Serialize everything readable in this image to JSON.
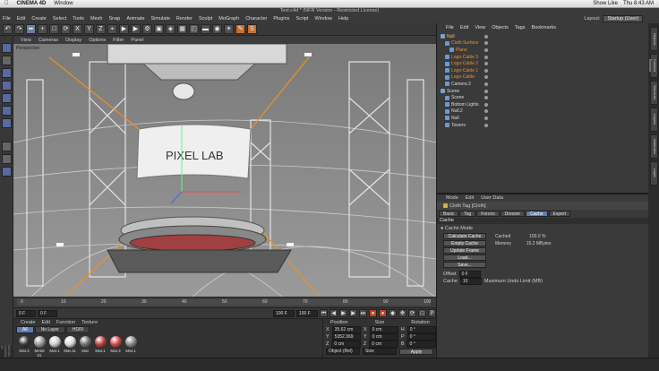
{
  "mac_menubar": {
    "app": "CINEMA 4D",
    "menu": "Window",
    "status_right": [
      "Show Like",
      "Thu 8:43 AM"
    ]
  },
  "app_title": "Test.c4d * (NFR Version - Restricted License)",
  "main_menu": [
    "File",
    "Edit",
    "Create",
    "Select",
    "Tools",
    "Mesh",
    "Snap",
    "Animate",
    "Simulate",
    "Render",
    "Sculpt",
    "MoGraph",
    "Character",
    "Plugins",
    "Script",
    "Window",
    "Help"
  ],
  "layout": {
    "label": "Layout:",
    "value": "Startup (User)"
  },
  "viewport": {
    "menu": [
      "View",
      "Cameras",
      "Display",
      "Options",
      "Filter",
      "Panel"
    ],
    "label": "Perspective",
    "screen_text": "PIXEL LAB"
  },
  "timeline": {
    "ticks": [
      "0",
      "10",
      "20",
      "30",
      "40",
      "50",
      "60",
      "70",
      "80",
      "90",
      "100"
    ],
    "frame_label": "0 F"
  },
  "playback": {
    "start": "0 F",
    "current": "0 F",
    "end": "100 F",
    "max": "100 F"
  },
  "material_manager": {
    "menu": [
      "Create",
      "Edit",
      "Function",
      "Texture"
    ],
    "tabs": [
      "All",
      "No Layer",
      "HDRI"
    ],
    "materials": [
      {
        "name": "Mat.3",
        "color": "#3a3a3a"
      },
      {
        "name": "Metal 01",
        "color": "#9a9a9a"
      },
      {
        "name": "Mat.1",
        "color": "#cfcfcf"
      },
      {
        "name": "Mat.11",
        "color": "#dcdcdc"
      },
      {
        "name": "Mat",
        "color": "#707070"
      },
      {
        "name": "Mat.1",
        "color": "#bb4444"
      },
      {
        "name": "Mat.3",
        "color": "#d04a4a"
      },
      {
        "name": "Mat.1",
        "color": "#8a8a8a"
      }
    ]
  },
  "coordinates": {
    "headers": [
      "Position",
      "Size",
      "Rotation"
    ],
    "rows": [
      {
        "axis": "X",
        "pos": "35.62 cm",
        "size_axis": "X",
        "size": "0 cm",
        "rot_axis": "H",
        "rot": "0 °"
      },
      {
        "axis": "Y",
        "pos": "5352.369 cm",
        "size_axis": "Y",
        "size": "0 cm",
        "rot_axis": "P",
        "rot": "0 °"
      },
      {
        "axis": "Z",
        "pos": "0 cm",
        "size_axis": "Z",
        "size": "0 cm",
        "rot_axis": "B",
        "rot": "0 °"
      }
    ],
    "mode_object": "Object (Rel)",
    "mode_size": "Size",
    "apply": "Apply"
  },
  "object_manager": {
    "menu": [
      "File",
      "Edit",
      "View",
      "Objects",
      "Tags",
      "Bookmarks"
    ],
    "objects": [
      {
        "name": "Null",
        "color": "#e8c060",
        "indent": 0
      },
      {
        "name": "Cloth Surface",
        "color": "#e89030",
        "indent": 1
      },
      {
        "name": "Plane",
        "color": "#e89030",
        "indent": 2
      },
      {
        "name": "Logo-Cable 3",
        "color": "#e89030",
        "indent": 1
      },
      {
        "name": "Logo-Cable 2",
        "color": "#e89030",
        "indent": 1
      },
      {
        "name": "Logo-Cable 1",
        "color": "#e89030",
        "indent": 1
      },
      {
        "name": "Logo-Cable",
        "color": "#e89030",
        "indent": 1
      },
      {
        "name": "Camera 2",
        "color": "#dddddd",
        "indent": 1
      },
      {
        "name": "Scene",
        "color": "#dddddd",
        "indent": 0
      },
      {
        "name": "Scene",
        "color": "#dddddd",
        "indent": 1
      },
      {
        "name": "Bottom Lights",
        "color": "#dddddd",
        "indent": 1
      },
      {
        "name": "Null.2",
        "color": "#dddddd",
        "indent": 1
      },
      {
        "name": "Null",
        "color": "#dddddd",
        "indent": 1
      },
      {
        "name": "Towers",
        "color": "#dddddd",
        "indent": 1
      }
    ]
  },
  "attributes": {
    "menu": [
      "Mode",
      "Edit",
      "User Data"
    ],
    "title": "Cloth Tag [Cloth]",
    "tabs": [
      "Basic",
      "Tag",
      "Forces",
      "Dresser",
      "Cache",
      "Expert"
    ],
    "section": "Cache",
    "cache_mode_label": "Cache Mode",
    "buttons": [
      "Calculate Cache",
      "Empty Cache",
      "Update Frame",
      "Load...",
      "Save..."
    ],
    "cached_label": "Cached",
    "cached_value": "100.0 %",
    "memory_label": "Memory",
    "memory_value": "15.2 MBytes",
    "offset_label": "Offset",
    "offset_value": "0 F",
    "cache_label": "Cache",
    "cache_value": "10",
    "undo_label": "Maximum Undo Limit (MB)"
  },
  "side_tabs": [
    "Objects",
    "Content Browser",
    "Structure",
    "Layers",
    "Attributes",
    "Layer"
  ],
  "logo": "MAXON CINEMA 4D"
}
